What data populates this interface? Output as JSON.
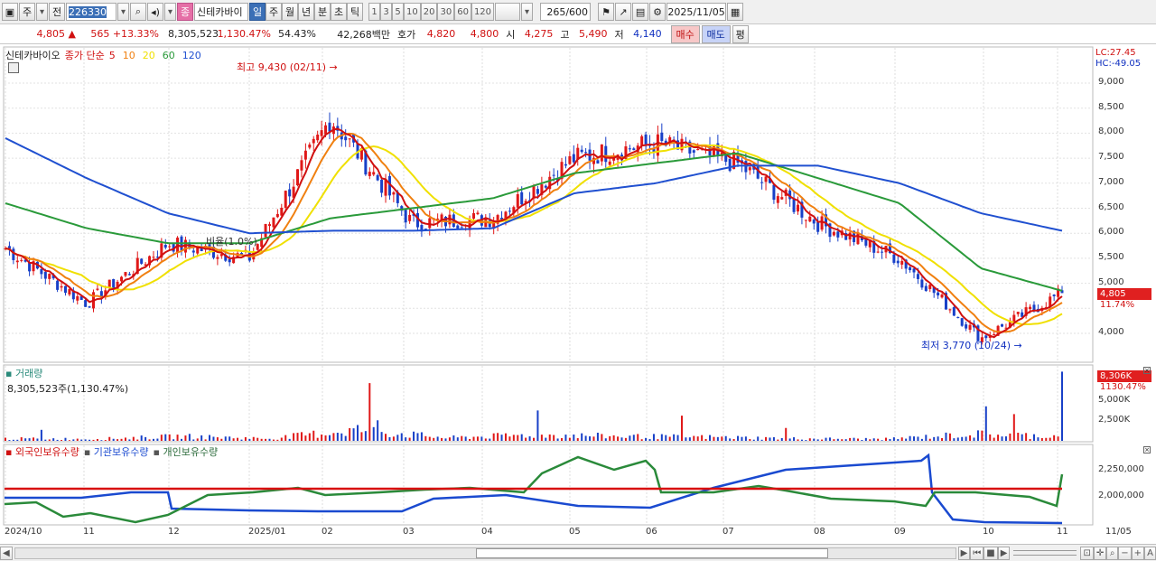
{
  "toolbar": {
    "market": "주",
    "type": "전",
    "code": "226330",
    "name": "신테카바이",
    "periods": [
      "일",
      "주",
      "월",
      "년",
      "분",
      "초",
      "틱"
    ],
    "active_period": "일",
    "ticks": [
      "1",
      "3",
      "5",
      "10",
      "20",
      "30",
      "60",
      "120"
    ],
    "count": "265",
    "count_max": "/600",
    "date": "2025/11/05"
  },
  "quote": {
    "price": "4,805",
    "change": "565",
    "change_pct": "+13.33%",
    "volume": "8,305,523",
    "vol_ratio": "1,130.47%",
    "turnover": "54.43%",
    "amount": "42,268백만",
    "hoga_label": "호가",
    "ask": "4,820",
    "bid": "4,800",
    "open_label": "시",
    "open": "4,275",
    "high_label": "고",
    "high": "5,490",
    "low_label": "저",
    "low": "4,140",
    "buy_btn": "매수",
    "sell_btn": "매도",
    "eval_btn": "평"
  },
  "price_panel": {
    "name": "신테카바이오",
    "ma_label": "종가 단순",
    "ma_periods": [
      "5",
      "10",
      "20",
      "60",
      "120"
    ],
    "ma_colors": [
      "#d01010",
      "#f08010",
      "#f0e000",
      "#2a9a3a",
      "#2050d0"
    ],
    "lc": "LC:27.45",
    "hc": "HC:-49.05",
    "max_label": "최고 9,430 (02/11)",
    "min_label": "최저 3,770 (10/24)",
    "annotation": "비율(1.0%)",
    "price_tag": "4,805",
    "price_pct": "11.74%",
    "yticks": [
      "9,000",
      "8,500",
      "8,000",
      "7,500",
      "7,000",
      "6,500",
      "6,000",
      "5,500",
      "5,000",
      "4,500",
      "4,000"
    ]
  },
  "volume_panel": {
    "title": "거래량",
    "value": "8,305,523주(1,130.47%)",
    "tag": "8,306K",
    "tag_pct": "1130.47%",
    "yticks": [
      "5,000K",
      "2,500K"
    ]
  },
  "holding_panel": {
    "legend": [
      "외국인보유수량",
      "기관보유수량",
      "개인보유수량"
    ],
    "colors": [
      "#1a4ad0",
      "#1a4ad0",
      "#2a8a3a"
    ],
    "yticks": [
      "2,250,000",
      "2,000,000"
    ]
  },
  "xaxis": [
    "2024/10",
    "11",
    "12",
    "2025/01",
    "02",
    "03",
    "04",
    "05",
    "06",
    "07",
    "08",
    "09",
    "10",
    "11",
    "11/05"
  ],
  "chart_data": [
    {
      "type": "line",
      "title": "신테카바이오",
      "x": [
        "2024-10",
        "2024-11",
        "2024-12",
        "2025-01",
        "2025-02",
        "2025-03",
        "2025-04",
        "2025-05",
        "2025-06",
        "2025-07",
        "2025-08",
        "2025-09",
        "2025-10",
        "2025-11"
      ],
      "series": [
        {
          "name": "종가",
          "values": [
            5700,
            4600,
            5800,
            5500,
            8300,
            6200,
            6300,
            7500,
            7800,
            7400,
            6200,
            5500,
            3900,
            4805
          ]
        },
        {
          "name": "60",
          "values": [
            6600,
            6100,
            5800,
            5800,
            6300,
            6500,
            6700,
            7200,
            7400,
            7600,
            7100,
            6600,
            5300,
            4850
          ]
        },
        {
          "name": "120",
          "values": [
            7900,
            7100,
            6400,
            6000,
            6050,
            6050,
            6100,
            6800,
            7000,
            7350,
            7350,
            7000,
            6400,
            6050
          ]
        }
      ],
      "ylim": [
        3700,
        9500
      ]
    },
    {
      "type": "bar",
      "title": "거래량",
      "series": [
        {
          "name": "거래량",
          "values": [
            300,
            250,
            600,
            300,
            1500,
            400,
            800,
            600,
            500,
            300,
            250,
            900,
            600,
            8306
          ]
        }
      ],
      "ylim": [
        0,
        9000
      ]
    }
  ]
}
